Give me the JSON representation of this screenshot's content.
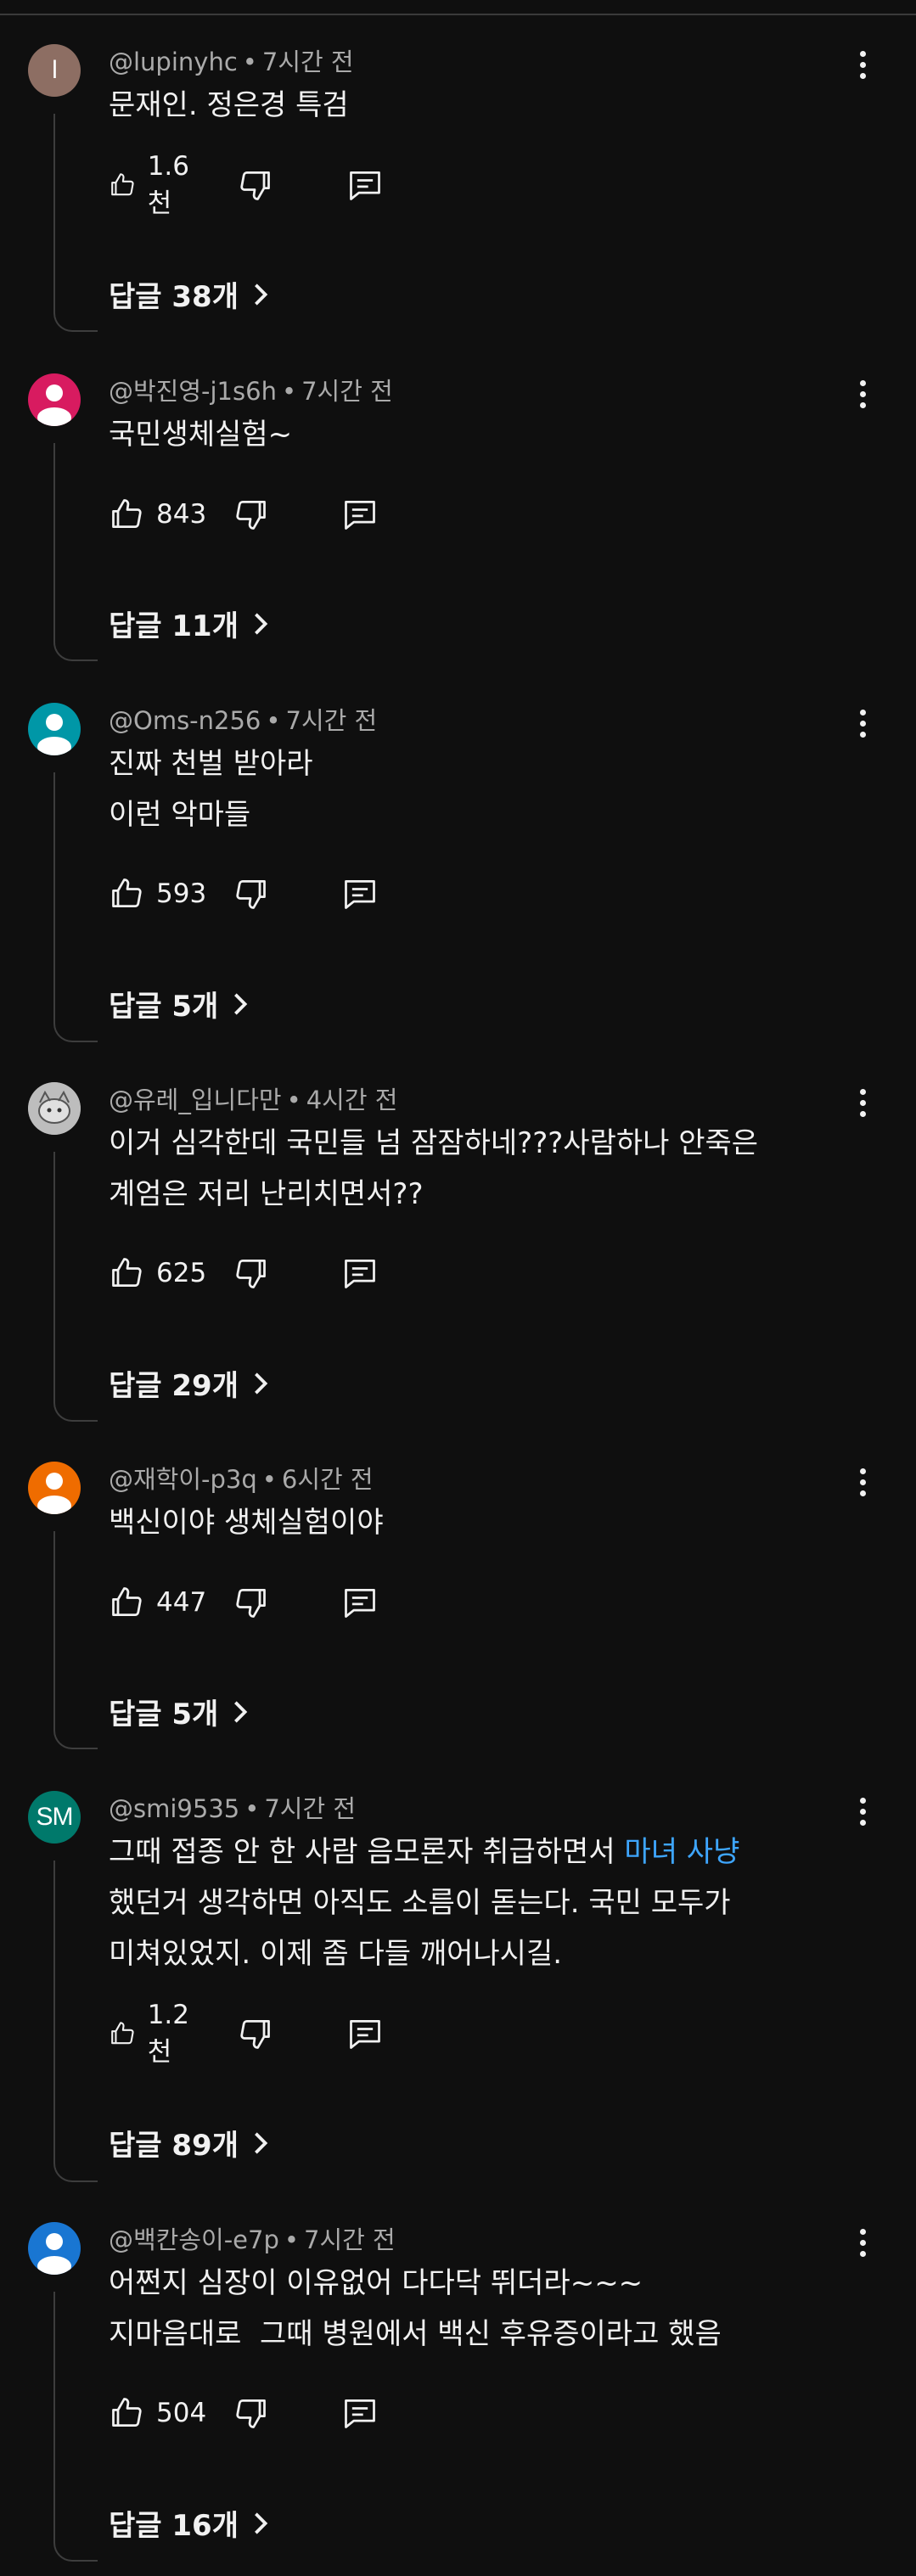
{
  "comments": [
    {
      "author": "@lupinyhc",
      "time": "7시간 전",
      "lines": [
        "문재인. 정은경 특검"
      ],
      "likes": "1.6천",
      "replies": "답글 38개",
      "avatar": {
        "type": "letter",
        "text": "l",
        "color": "#8d6e63"
      }
    },
    {
      "author": "@박진영-j1s6h",
      "time": "7시간 전",
      "lines": [
        "국민생체실험~"
      ],
      "likes": "843",
      "replies": "답글 11개",
      "avatar": {
        "type": "person",
        "color": "#d81b60"
      }
    },
    {
      "author": "@Oms-n256",
      "time": "7시간 전",
      "lines": [
        "진짜 천벌 받아라",
        "이런 악마들"
      ],
      "likes": "593",
      "replies": "답글 5개",
      "avatar": {
        "type": "person",
        "color": "#0097a7"
      }
    },
    {
      "author": "@유레_입니다만",
      "time": "4시간 전",
      "lines": [
        "이거 심각한데 국민들 넘 잠잠하네???사람하나 안죽은",
        "계엄은 저리 난리치면서??"
      ],
      "likes": "625",
      "replies": "답글 29개",
      "avatar": {
        "type": "sketch",
        "color": "#9e9e9e"
      }
    },
    {
      "author": "@재학이-p3q",
      "time": "6시간 전",
      "lines": [
        "백신이야 생체실험이야"
      ],
      "likes": "447",
      "replies": "답글 5개",
      "avatar": {
        "type": "person",
        "color": "#ef6c00"
      }
    },
    {
      "author": "@smi9535",
      "time": "7시간 전",
      "lines": [
        "그때 접종 안 한 사람 음모론자 취급하면서 ",
        "했던거 생각하면 아직도 소름이 돋는다. 국민 모두가",
        "미쳐있었지. 이제 좀 다들 깨어나시길."
      ],
      "link_text": "마녀 사냥",
      "likes": "1.2천",
      "replies": "답글 89개",
      "avatar": {
        "type": "letter",
        "text": "SM",
        "color": "#00796b"
      }
    },
    {
      "author": "@백칸송이-e7p",
      "time": "7시간 전",
      "lines": [
        "어쩐지 심장이 이유없어 다다닥 뛰더라~~~",
        "지마음대로  그때 병원에서 백신 후유증이라고 했음"
      ],
      "likes": "504",
      "replies": "답글 16개",
      "avatar": {
        "type": "person",
        "color": "#1976d2"
      }
    }
  ]
}
